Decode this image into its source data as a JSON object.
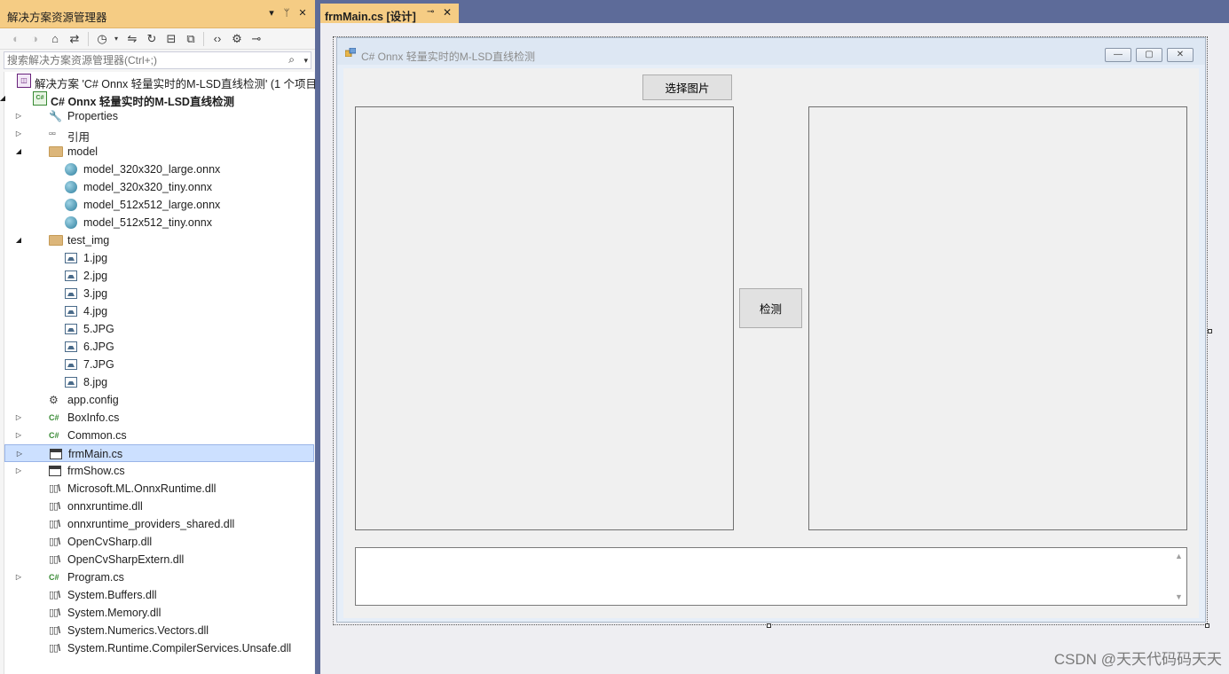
{
  "solution_explorer": {
    "title": "解决方案资源管理器",
    "title_buttons": [
      "▾",
      "ᛘ",
      "✕"
    ],
    "toolbar_icons": [
      "back-icon",
      "forward-icon",
      "home-icon",
      "switch-views-icon",
      "pending-changes-icon",
      "sync-icon",
      "refresh-icon",
      "collapse-all-icon",
      "show-all-files-icon",
      "view-code-icon",
      "properties-icon",
      "preview-icon"
    ],
    "search_placeholder": "搜索解决方案资源管理器(Ctrl+;)",
    "tree": [
      {
        "label": "解决方案 'C# Onnx 轻量实时的M-LSD直线检测' (1 个项目",
        "icon": "solution-icon",
        "depth": 0,
        "exp": ""
      },
      {
        "label": "C# Onnx 轻量实时的M-LSD直线检测",
        "icon": "csproj-icon",
        "depth": 0,
        "exp": "◢",
        "bold": true
      },
      {
        "label": "Properties",
        "icon": "wrench-icon",
        "depth": 1,
        "exp": "▷"
      },
      {
        "label": "引用",
        "icon": "references-icon",
        "depth": 1,
        "exp": "▷"
      },
      {
        "label": "model",
        "icon": "folder-icon",
        "depth": 1,
        "exp": "◢"
      },
      {
        "label": "model_320x320_large.onnx",
        "icon": "onnx-file-icon",
        "depth": 2,
        "exp": ""
      },
      {
        "label": "model_320x320_tiny.onnx",
        "icon": "onnx-file-icon",
        "depth": 2,
        "exp": ""
      },
      {
        "label": "model_512x512_large.onnx",
        "icon": "onnx-file-icon",
        "depth": 2,
        "exp": ""
      },
      {
        "label": "model_512x512_tiny.onnx",
        "icon": "onnx-file-icon",
        "depth": 2,
        "exp": ""
      },
      {
        "label": "test_img",
        "icon": "folder-icon",
        "depth": 1,
        "exp": "◢"
      },
      {
        "label": "1.jpg",
        "icon": "image-file-icon",
        "depth": 2,
        "exp": ""
      },
      {
        "label": "2.jpg",
        "icon": "image-file-icon",
        "depth": 2,
        "exp": ""
      },
      {
        "label": "3.jpg",
        "icon": "image-file-icon",
        "depth": 2,
        "exp": ""
      },
      {
        "label": "4.jpg",
        "icon": "image-file-icon",
        "depth": 2,
        "exp": ""
      },
      {
        "label": "5.JPG",
        "icon": "image-file-icon",
        "depth": 2,
        "exp": ""
      },
      {
        "label": "6.JPG",
        "icon": "image-file-icon",
        "depth": 2,
        "exp": ""
      },
      {
        "label": "7.JPG",
        "icon": "image-file-icon",
        "depth": 2,
        "exp": ""
      },
      {
        "label": "8.jpg",
        "icon": "image-file-icon",
        "depth": 2,
        "exp": ""
      },
      {
        "label": "app.config",
        "icon": "config-file-icon",
        "depth": 1,
        "exp": ""
      },
      {
        "label": "BoxInfo.cs",
        "icon": "csharp-file-icon",
        "depth": 1,
        "exp": "▷"
      },
      {
        "label": "Common.cs",
        "icon": "csharp-file-icon",
        "depth": 1,
        "exp": "▷"
      },
      {
        "label": "frmMain.cs",
        "icon": "form-file-icon",
        "depth": 1,
        "exp": "▷",
        "selected": true
      },
      {
        "label": "frmShow.cs",
        "icon": "form-file-icon",
        "depth": 1,
        "exp": "▷"
      },
      {
        "label": "Microsoft.ML.OnnxRuntime.dll",
        "icon": "dll-file-icon",
        "depth": 1,
        "exp": ""
      },
      {
        "label": "onnxruntime.dll",
        "icon": "dll-file-icon",
        "depth": 1,
        "exp": ""
      },
      {
        "label": "onnxruntime_providers_shared.dll",
        "icon": "dll-file-icon",
        "depth": 1,
        "exp": ""
      },
      {
        "label": "OpenCvSharp.dll",
        "icon": "dll-file-icon",
        "depth": 1,
        "exp": ""
      },
      {
        "label": "OpenCvSharpExtern.dll",
        "icon": "dll-file-icon",
        "depth": 1,
        "exp": ""
      },
      {
        "label": "Program.cs",
        "icon": "csharp-file-icon",
        "depth": 1,
        "exp": "▷"
      },
      {
        "label": "System.Buffers.dll",
        "icon": "dll-file-icon",
        "depth": 1,
        "exp": ""
      },
      {
        "label": "System.Memory.dll",
        "icon": "dll-file-icon",
        "depth": 1,
        "exp": ""
      },
      {
        "label": "System.Numerics.Vectors.dll",
        "icon": "dll-file-icon",
        "depth": 1,
        "exp": ""
      },
      {
        "label": "System.Runtime.CompilerServices.Unsafe.dll",
        "icon": "dll-file-icon",
        "depth": 1,
        "exp": ""
      }
    ]
  },
  "document_tab": {
    "label": "frmMain.cs [设计]",
    "pin": "⊸",
    "close": "✕"
  },
  "form": {
    "title": "C# Onnx 轻量实时的M-LSD直线检测",
    "caption_buttons": {
      "minimize": "—",
      "maximize": "▢",
      "close": "✕"
    },
    "select_image_button": "选择图片",
    "detect_button": "检测",
    "log_textbox_value": ""
  },
  "watermark": "CSDN @天天代码码天天",
  "colors": {
    "accent_tab": "#f5cc84",
    "ide_background": "#5d6b99",
    "selection": "#cce0ff"
  }
}
